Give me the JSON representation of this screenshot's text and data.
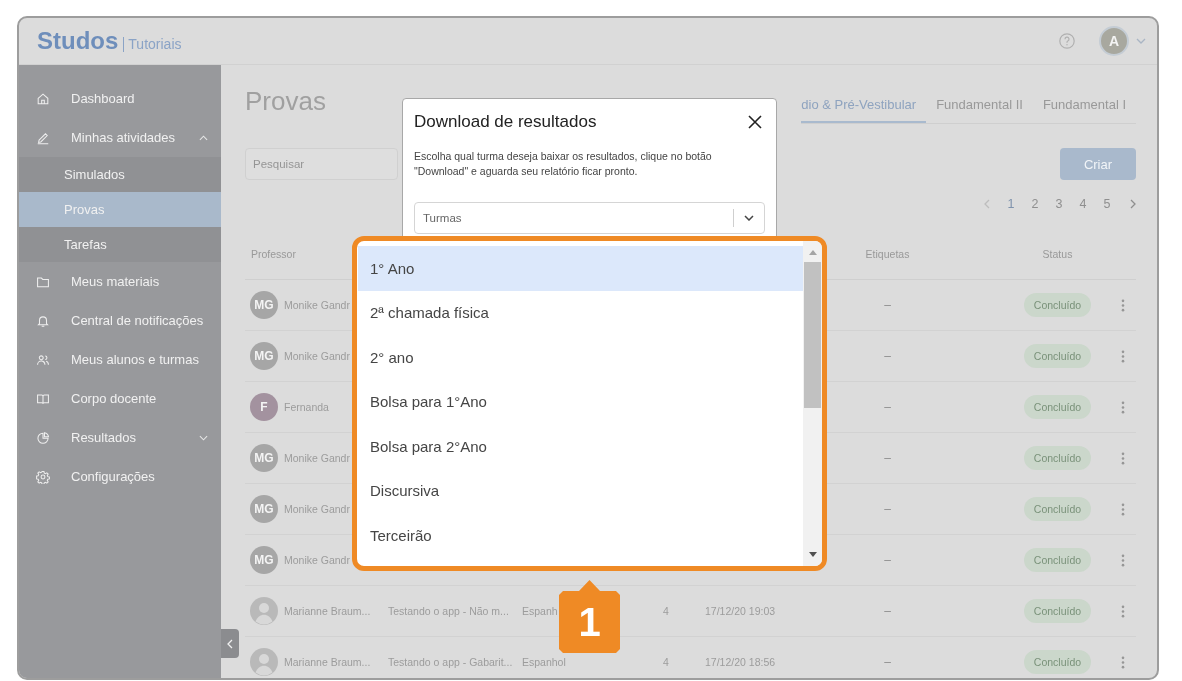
{
  "header": {
    "logo": "Studos",
    "logo_tag": "Tutoriais",
    "avatar_initial": "A"
  },
  "sidebar": {
    "items": [
      {
        "kind": "link",
        "label": "Dashboard",
        "selected": false
      },
      {
        "kind": "group",
        "label": "Minhas atividades",
        "selected": false,
        "expanded": true,
        "children": [
          {
            "label": "Simulados",
            "selected": false
          },
          {
            "label": "Provas",
            "selected": true
          },
          {
            "label": "Tarefas",
            "selected": false
          }
        ]
      },
      {
        "kind": "link",
        "label": "Meus materiais",
        "selected": false
      },
      {
        "kind": "link",
        "label": "Central de notificações",
        "selected": false
      },
      {
        "kind": "link",
        "label": "Meus alunos e turmas",
        "selected": false
      },
      {
        "kind": "link",
        "label": "Corpo docente",
        "selected": false
      },
      {
        "kind": "group",
        "label": "Resultados",
        "selected": false,
        "expanded": false
      },
      {
        "kind": "link",
        "label": "Configurações",
        "selected": false
      }
    ]
  },
  "content": {
    "title": "Provas",
    "tabs": [
      {
        "label": "dio & Pré-Vestibular",
        "selected": true
      },
      {
        "label": "Fundamental II",
        "selected": false
      },
      {
        "label": "Fundamental I",
        "selected": false
      }
    ],
    "search": {
      "placeholder": "Pesquisar"
    },
    "create_button": "Criar",
    "pagination": {
      "prev_disabled": true,
      "next_disabled": false,
      "pages": [
        {
          "label": "1",
          "selected": true
        },
        {
          "label": "2",
          "selected": false
        },
        {
          "label": "3",
          "selected": false
        },
        {
          "label": "4",
          "selected": false
        },
        {
          "label": "5",
          "selected": false
        }
      ]
    },
    "table": {
      "columns": [
        "Professor",
        "Etiquetas",
        "Status"
      ],
      "rows": [
        {
          "avatar": {
            "kind": "initials",
            "text": "MG",
            "color": "#a6a6a6"
          },
          "professor": "Monike Gandr",
          "tags": "–",
          "status": "Concluído"
        },
        {
          "avatar": {
            "kind": "initials",
            "text": "MG",
            "color": "#a6a6a6"
          },
          "professor": "Monike Gandr",
          "tags": "–",
          "status": "Concluído"
        },
        {
          "avatar": {
            "kind": "initials",
            "text": "F",
            "color": "#a3929f"
          },
          "professor": "Fernanda",
          "tags": "–",
          "status": "Concluído"
        },
        {
          "avatar": {
            "kind": "initials",
            "text": "MG",
            "color": "#a6a6a6"
          },
          "professor": "Monike Gandr",
          "tags": "–",
          "status": "Concluído"
        },
        {
          "avatar": {
            "kind": "initials",
            "text": "MG",
            "color": "#a6a6a6"
          },
          "professor": "Monike Gandr",
          "tags": "–",
          "status": "Concluído"
        },
        {
          "avatar": {
            "kind": "initials",
            "text": "MG",
            "color": "#a6a6a6"
          },
          "professor": "Monike Gandr",
          "tags": "–",
          "status": "Concluído"
        },
        {
          "avatar": {
            "kind": "photo"
          },
          "professor": "Marianne Braum...",
          "title": "Testando o app - Não m...",
          "subject": "Espanh",
          "questions": "4",
          "date": "17/12/20 19:03",
          "tags": "–",
          "status": "Concluído"
        },
        {
          "avatar": {
            "kind": "photo"
          },
          "professor": "Marianne Braum...",
          "title": "Testando o app - Gabarit...",
          "subject": "Espanhol",
          "questions": "4",
          "date": "17/12/20 18:56",
          "tags": "–",
          "status": "Concluído"
        }
      ]
    }
  },
  "modal": {
    "title": "Download de resultados",
    "description": "Escolha qual turma deseja baixar os resultados, clique no botão \"Download\" e aguarda seu relatório ficar pronto.",
    "select": {
      "placeholder": "Turmas"
    }
  },
  "dropdown": {
    "options": [
      {
        "label": "1° Ano",
        "selected": true
      },
      {
        "label": "2ª chamada física",
        "selected": false
      },
      {
        "label": "2° ano",
        "selected": false
      },
      {
        "label": "Bolsa para 1°Ano",
        "selected": false
      },
      {
        "label": "Bolsa para 2°Ano",
        "selected": false
      },
      {
        "label": "Discursiva",
        "selected": false
      },
      {
        "label": "Terceirão",
        "selected": false
      }
    ]
  },
  "callout": {
    "number": "1"
  }
}
